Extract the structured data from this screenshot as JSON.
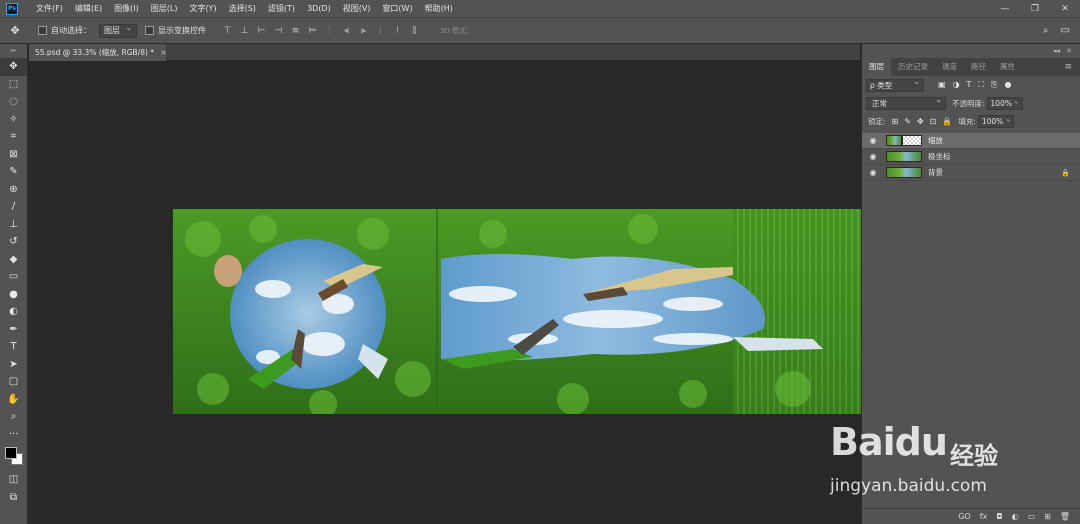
{
  "app": {
    "logo": "Ps"
  },
  "menu": {
    "items": [
      "文件(F)",
      "编辑(E)",
      "图像(I)",
      "图层(L)",
      "文字(Y)",
      "选择(S)",
      "滤镜(T)",
      "3D(D)",
      "视图(V)",
      "窗口(W)",
      "帮助(H)"
    ],
    "window_controls": [
      "—",
      "❐",
      "✕"
    ]
  },
  "options": {
    "auto_select_label": "自动选择：",
    "auto_select_value": "图层",
    "show_transform_label": "显示变换控件",
    "mode_3d_label": "3D 模式：",
    "align_icons": [
      "⊤",
      "⊥",
      "⊢",
      "⊣",
      "≡",
      "⊨",
      "⫶",
      "⫷",
      "⫸",
      "⦙",
      "⦚",
      "⫿"
    ]
  },
  "document": {
    "tab_title": "55.psd @ 33.3% (缩放, RGB/8) *",
    "close_glyph": "×",
    "image_colors": {
      "grass": "#3e7e20",
      "grass_light": "#6fb23c",
      "sky": "#6aa6cf",
      "cloud": "#eef4fa"
    }
  },
  "toolbar": {
    "grip": "▸▸",
    "tools": [
      {
        "name": "move-tool",
        "glyph": "✥",
        "active": true
      },
      {
        "name": "marquee-tool",
        "glyph": "⬚"
      },
      {
        "name": "lasso-tool",
        "glyph": "◌"
      },
      {
        "name": "magic-wand-tool",
        "glyph": "✧"
      },
      {
        "name": "crop-tool",
        "glyph": "⌗"
      },
      {
        "name": "frame-tool",
        "glyph": "⊠"
      },
      {
        "name": "eyedropper-tool",
        "glyph": "✎"
      },
      {
        "name": "healing-tool",
        "glyph": "⊕"
      },
      {
        "name": "brush-tool",
        "glyph": "∕"
      },
      {
        "name": "stamp-tool",
        "glyph": "⊥"
      },
      {
        "name": "history-brush-tool",
        "glyph": "↺"
      },
      {
        "name": "eraser-tool",
        "glyph": "◆"
      },
      {
        "name": "gradient-tool",
        "glyph": "▭"
      },
      {
        "name": "blur-tool",
        "glyph": "●"
      },
      {
        "name": "dodge-tool",
        "glyph": "◐"
      },
      {
        "name": "pen-tool",
        "glyph": "✒"
      },
      {
        "name": "type-tool",
        "glyph": "T"
      },
      {
        "name": "path-select-tool",
        "glyph": "➤"
      },
      {
        "name": "shape-tool",
        "glyph": "▢"
      },
      {
        "name": "hand-tool",
        "glyph": "✋"
      },
      {
        "name": "zoom-tool",
        "glyph": "⌕"
      },
      {
        "name": "more-tools",
        "glyph": "···"
      }
    ],
    "bottom_tools": [
      {
        "name": "quick-mask-tool",
        "glyph": "◫"
      },
      {
        "name": "screen-mode-tool",
        "glyph": "⧉"
      }
    ]
  },
  "layers_panel": {
    "top_glyphs": [
      "◂◂",
      "✕"
    ],
    "tabs": [
      "图层",
      "历史记录",
      "通道",
      "路径",
      "属性"
    ],
    "menu_glyph": "≡",
    "filter_value": "ρ 类型",
    "filter_icons": [
      "▣",
      "◑",
      "T",
      "⛶",
      "⎘",
      "●"
    ],
    "blend_mode": "正常",
    "opacity_label": "不透明度:",
    "opacity_value": "100%",
    "lock_label": "锁定:",
    "lock_icons": [
      "⊞",
      "✎",
      "✥",
      "⊡",
      "🔒"
    ],
    "fill_label": "填充:",
    "fill_value": "100%",
    "layers": [
      {
        "name": "缩放",
        "visible_glyph": "◉",
        "selected": true,
        "has_mask": true,
        "locked": false
      },
      {
        "name": "极坐标",
        "visible_glyph": "◉",
        "selected": false,
        "has_mask": false,
        "locked": false
      },
      {
        "name": "背景",
        "visible_glyph": "◉",
        "selected": false,
        "has_mask": false,
        "locked": true,
        "lock_glyph": "🔒"
      }
    ],
    "bottom_icons": [
      "GO",
      "fx",
      "◘",
      "◐",
      "▭",
      "⊞",
      "🗑"
    ]
  },
  "watermark": {
    "logo_left": "Bai",
    "logo_mid": "du",
    "logo_right": "经验",
    "url": "jingyan.baidu.com"
  }
}
